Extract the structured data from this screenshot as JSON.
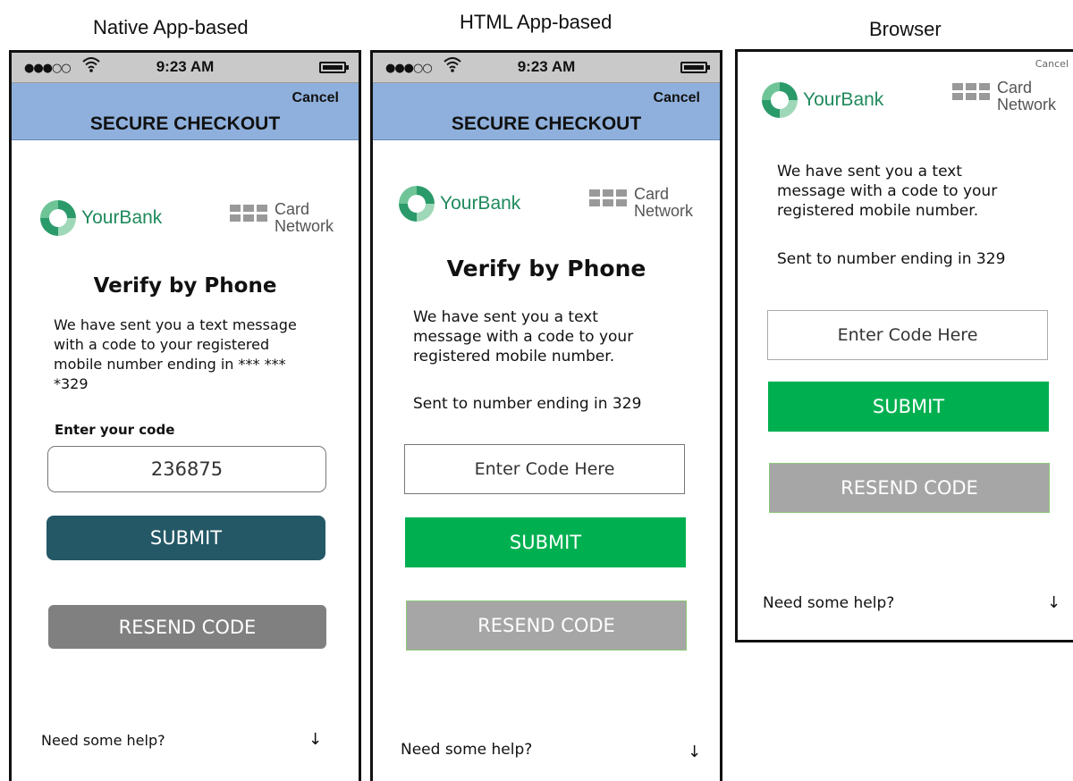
{
  "columns": {
    "native": "Native App-based",
    "html": "HTML App-based",
    "browser": "Browser"
  },
  "status_bar": {
    "time": "9:23 AM"
  },
  "header": {
    "cancel": "Cancel",
    "title": "SECURE CHECKOUT"
  },
  "logos": {
    "bank": "YourBank",
    "card_line1": "Card",
    "card_line2": "Network"
  },
  "native": {
    "heading": "Verify by Phone",
    "message_lines": [
      "We have sent you a text message",
      "with a code to your registered",
      "mobile number ending in  *** ***",
      "*329"
    ],
    "code_label": "Enter your code",
    "code_value": "236875",
    "submit": "SUBMIT",
    "resend": "RESEND CODE",
    "help": "Need some help?"
  },
  "html": {
    "heading": "Verify by Phone",
    "message_lines": [
      "We have sent you a text",
      "message with a code to your",
      "registered mobile number."
    ],
    "sent_to": "Sent to number ending in  329",
    "code_placeholder": "Enter Code Here",
    "submit": "SUBMIT",
    "resend": "RESEND CODE",
    "help": "Need some help?"
  },
  "browser": {
    "cancel": "Cancel",
    "message_lines": [
      "We have sent you a text",
      "message with a code to your",
      "registered mobile number."
    ],
    "sent_to": "Sent to number ending in  329",
    "code_placeholder": "Enter Code Here",
    "submit": "SUBMIT",
    "resend": "RESEND CODE",
    "help": "Need some help?"
  },
  "icons": {
    "signal": "signal-dots-icon",
    "wifi": "wifi-icon",
    "battery": "battery-icon",
    "help_arrow": "arrow-down-icon",
    "card_network_grid": "grid-icon",
    "bank_logo": "bank-ring-logo"
  },
  "colors": {
    "header_bg": "#8fb0dc",
    "native_submit": "#245866",
    "native_resend": "#808080",
    "green_submit": "#00b050",
    "gray_resend": "#a6a6a6",
    "bank_green": "#1f8a5c"
  }
}
